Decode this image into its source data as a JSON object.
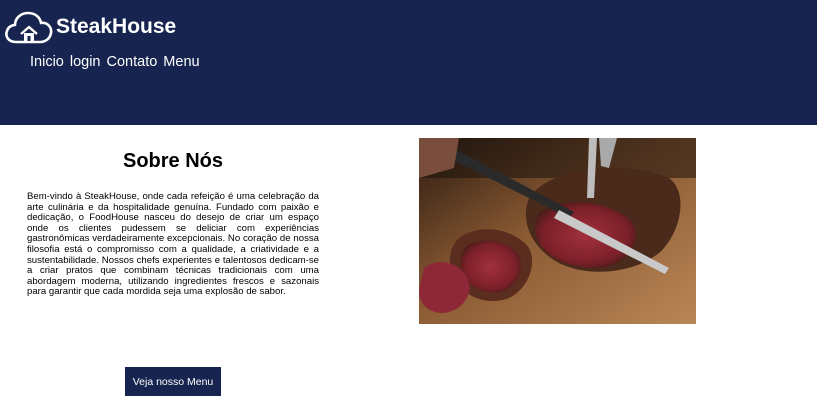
{
  "header": {
    "brand_name": "SteakHouse",
    "logo_icon": "cloud-house-icon",
    "background_color": "#16244f"
  },
  "nav": {
    "items": [
      {
        "label": "Inicio"
      },
      {
        "label": "login"
      },
      {
        "label": "Contato"
      },
      {
        "label": "Menu"
      }
    ]
  },
  "about": {
    "title": "Sobre Nós",
    "text": "Bem-vindo à SteakHouse, onde cada refeição é uma celebração da arte culinária e da hospitalidade genuína. Fundado com paixão e dedicação, o FoodHouse nasceu do desejo de criar um espaço onde os clientes pudessem se deliciar com experiências gastronômicas verdadeiramente excepcionais. No coração de nossa filosofia está o compromisso com a qualidade, a criatividade e a sustentabilidade. Nossos chefs experientes e talentosos dedicam-se a criar pratos que combinam técnicas tradicionais com uma abordagem moderna, utilizando ingredientes frescos e sazonais para garantir que cada mordida seja uma explosão de sabor.",
    "button_label": "Veja nosso Menu"
  }
}
